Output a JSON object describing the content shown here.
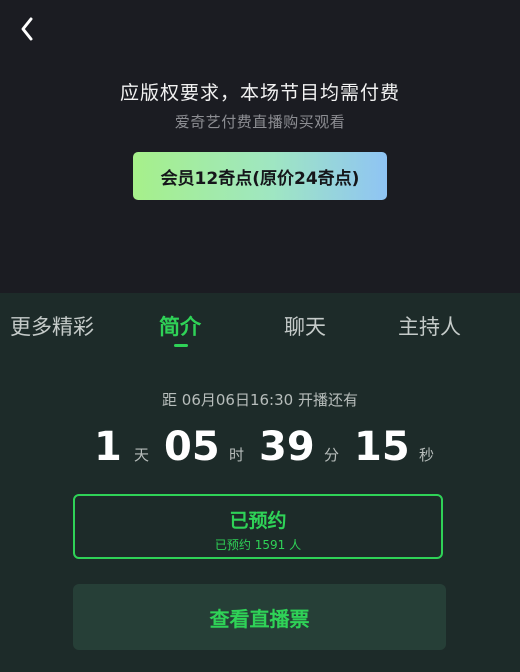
{
  "header": {
    "back_icon": "chevron-left-icon",
    "notice_title": "应版权要求，本场节目均需付费",
    "notice_subtitle": "爱奇艺付费直播购买观看",
    "member_button_label": "会员12奇点(原价24奇点)"
  },
  "tabs": [
    {
      "label": "更多精彩",
      "active": false
    },
    {
      "label": "简介",
      "active": true
    },
    {
      "label": "聊天",
      "active": false
    },
    {
      "label": "主持人",
      "active": false
    }
  ],
  "countdown": {
    "label": "距 06月06日16:30 开播还有",
    "days": "1",
    "days_unit": "天",
    "hours": "05",
    "hours_unit": "时",
    "minutes": "39",
    "minutes_unit": "分",
    "seconds": "15",
    "seconds_unit": "秒"
  },
  "reserve": {
    "label": "已预约",
    "count_text": "已预约 1591 人"
  },
  "ticket": {
    "label": "查看直播票"
  },
  "colors": {
    "accent": "#2fd257",
    "top_bg": "#1b1c22",
    "bottom_bg": "#1d2b29",
    "ticket_bg": "#263f37"
  }
}
